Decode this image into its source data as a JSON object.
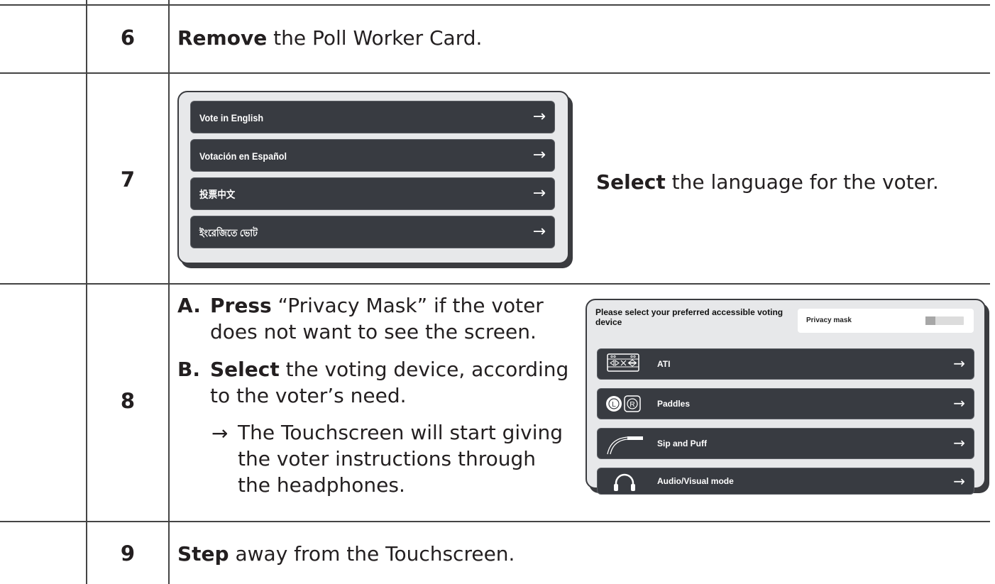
{
  "steps": [
    {
      "number": "6",
      "text_bold": "Remove",
      "text_rest": " the Poll Worker Card."
    },
    {
      "number": "7",
      "text_bold": "Select",
      "text_rest": " the language for the voter."
    },
    {
      "number": "8",
      "items": [
        {
          "marker": "A.",
          "bold": "Press",
          "rest": " “Privacy Mask” if the voter",
          "cont": "does not want to see the screen."
        },
        {
          "marker": "B.",
          "bold": "Select",
          "rest": " the voting device, according",
          "cont": "to the voter’s need."
        }
      ],
      "result_arrow": "→",
      "result_lines": [
        "The Touchscreen will start giving",
        "the voter instructions through",
        "the headphones."
      ]
    },
    {
      "number": "9",
      "text_bold": "Step",
      "text_rest": " away from the Touchscreen."
    }
  ],
  "language_screen": {
    "buttons": [
      {
        "label": "Vote in English",
        "arrow": "→"
      },
      {
        "label": "Votación en Español",
        "arrow": "→"
      },
      {
        "label": "投票中文",
        "arrow": "→"
      },
      {
        "label": "ইংরেজিতে ভোট",
        "arrow": "→"
      }
    ]
  },
  "device_screen": {
    "header": "Please select your preferred accessible voting device",
    "privacy_label": "Privacy mask",
    "privacy_on": false,
    "buttons": [
      {
        "label": "ATI",
        "icon": "ati-keypad-icon",
        "arrow": "→"
      },
      {
        "label": "Paddles",
        "icon": "paddles-icon",
        "arrow": "→"
      },
      {
        "label": "Sip and Puff",
        "icon": "sip-puff-icon",
        "arrow": "→"
      },
      {
        "label": "Audio/Visual mode",
        "icon": "headphones-icon",
        "arrow": "→"
      }
    ]
  },
  "colors": {
    "button_bg": "#383b41",
    "screen_bg": "#e7e8ea",
    "text": "#231f20"
  }
}
